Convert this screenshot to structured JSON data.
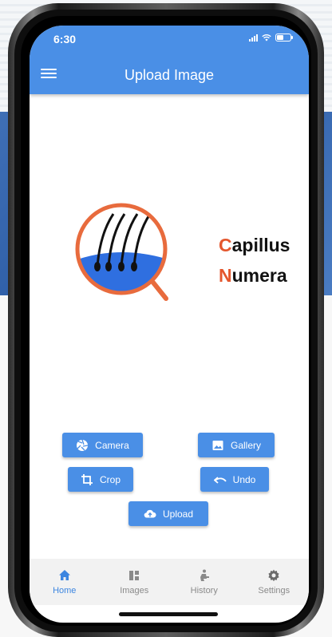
{
  "status_bar": {
    "time": "6:30"
  },
  "app_bar": {
    "title": "Upload Image"
  },
  "logo": {
    "line1_first": "C",
    "line1_rest": "apillus",
    "line2_first": "N",
    "line2_rest": "umera"
  },
  "buttons": {
    "camera": "Camera",
    "gallery": "Gallery",
    "crop": "Crop",
    "undo": "Undo",
    "upload": "Upload"
  },
  "bottom_nav": [
    {
      "label": "Home",
      "icon": "home-icon",
      "active": true
    },
    {
      "label": "Images",
      "icon": "dashboard-icon",
      "active": false
    },
    {
      "label": "History",
      "icon": "history-icon",
      "active": false
    },
    {
      "label": "Settings",
      "icon": "gear-icon",
      "active": false
    }
  ],
  "colors": {
    "primary": "#4a8fe6",
    "active_nav": "#3d86e0",
    "logo_orange": "#e4572e",
    "logo_blue": "#2f6fe0"
  }
}
